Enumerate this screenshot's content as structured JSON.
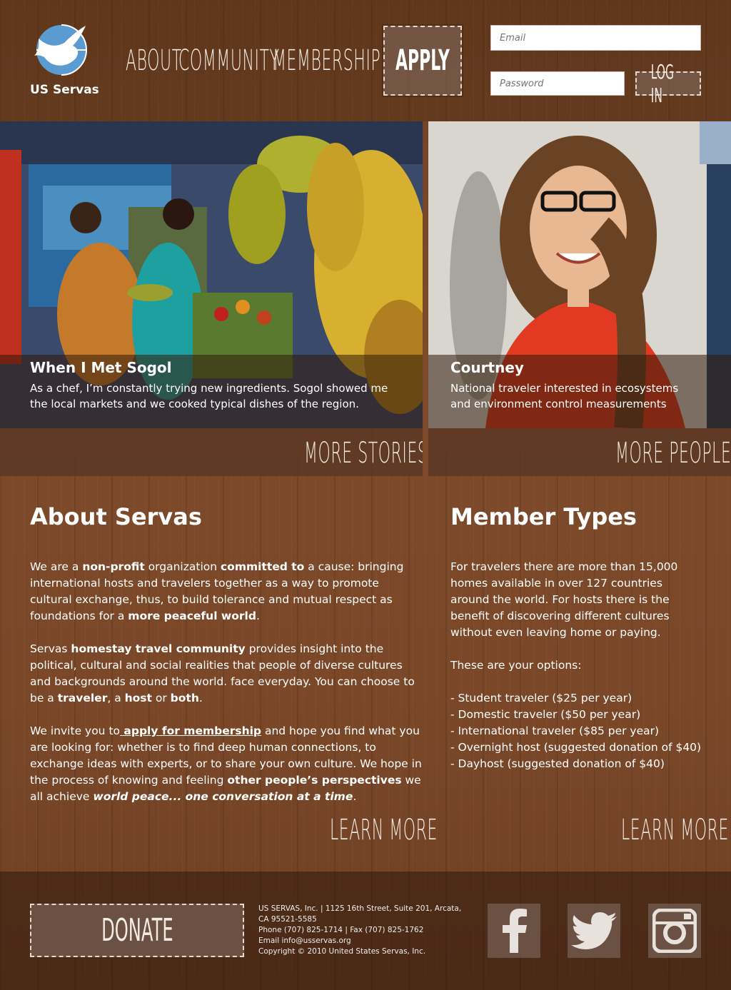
{
  "header": {
    "logo_text": "US Servas",
    "nav": [
      {
        "label": "ABOUT"
      },
      {
        "label": "COMMUNITY"
      },
      {
        "label": "MEMBERSHIP"
      }
    ],
    "apply_label": "APPLY",
    "email_placeholder": "Email",
    "password_placeholder": "Password",
    "login_label": "LOG IN"
  },
  "stories": {
    "title": "When I Met Sogol",
    "text": "As a chef, I’m constantly trying new ingredients. Sogol showed me the local markets and we cooked typical dishes of the region.",
    "more_label": "MORE STORIES"
  },
  "people": {
    "title": "Courtney",
    "text": "National traveler interested in ecosystems and environment control measurements",
    "more_label": "MORE PEOPLE"
  },
  "about": {
    "title": "About Servas",
    "p1": {
      "a": "We are a ",
      "b": "non-profit",
      "c": " organization ",
      "d": "committed to",
      "e": " a cause: bringing international hosts and travelers together as a way to promote cultural exchange, thus, to build tolerance and mutual respect as foundations for a ",
      "f": "more peaceful world",
      "g": "."
    },
    "p2": {
      "a": "Servas ",
      "b": "homestay travel community",
      "c": " provides insight into the political, cultural and social realities that people of diverse cultures and backgrounds around the world. face everyday. You can choose to be a ",
      "d": "traveler",
      "e": ", a ",
      "f": "host",
      "g": " or ",
      "h": "both",
      "i": "."
    },
    "p3": {
      "a": "We invite you to",
      "link": " apply for membership",
      "b": " and hope you find what you are looking for: whether is to find deep human connections,  to exchange ideas with experts,  or to share your own culture. We hope in the process of knowing and feeling ",
      "c": "other people’s perspectives",
      "d": " we all achieve ",
      "e": "world peace... one conversation at a time",
      "f": "."
    },
    "learn_more": "LEARN MORE"
  },
  "member_types": {
    "title": "Member Types",
    "intro": "For travelers there are more than 15,000 homes available in over 127 countries around the world. For hosts there is the benefit of discovering different cultures without even leaving home or paying.",
    "options_label": "These are your options:",
    "options": [
      "- Student traveler ($25 per year)",
      "- Domestic traveler ($50 per year)",
      "- International traveler ($85 per year)",
      "- Overnight host (suggested donation of $40)",
      "- Dayhost (suggested donation of $40)"
    ],
    "learn_more": "LEARN MORE"
  },
  "footer": {
    "donate_label": "DONATE",
    "address_line1": "US SERVAS, Inc. | 1125 16th Street, Suite 201, Arcata, CA 95521-5585",
    "phone": "Phone (707) 825-1714 | Fax (707) 825-1762",
    "email": "Email info@usservas.org",
    "copyright": "Copyright © 2010 United States Servas, Inc."
  },
  "social": {
    "icons": [
      "facebook-icon",
      "twitter-icon",
      "instagram-icon"
    ]
  },
  "colors": {
    "wood": "#7a4a2a",
    "button_fill": "#6e5548",
    "logo_blue": "#5aa6e6"
  }
}
